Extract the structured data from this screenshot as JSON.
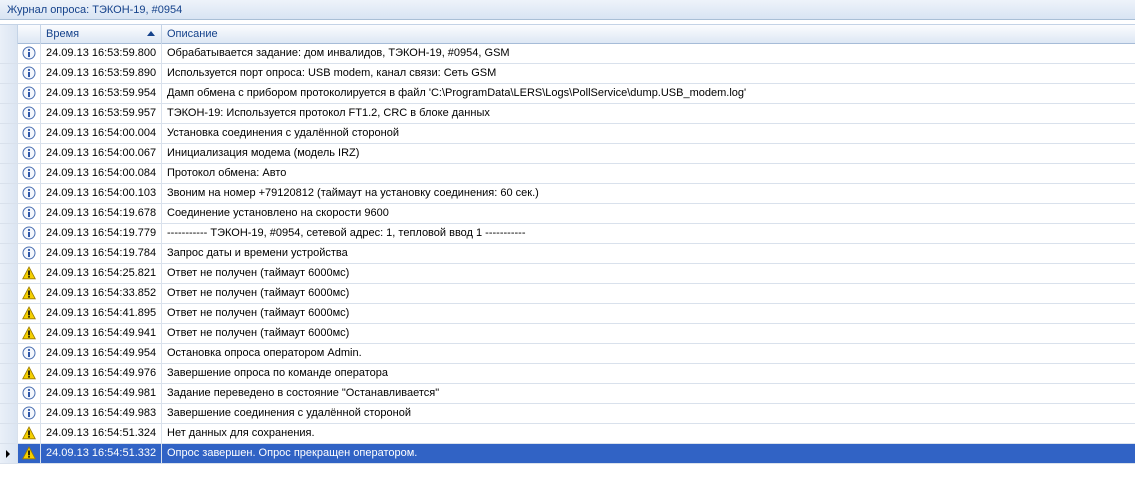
{
  "window": {
    "title": "Журнал опроса: ТЭКОН-19, #0954"
  },
  "columns": {
    "time": "Время",
    "description": "Описание"
  },
  "colors": {
    "info": "#4a6fb1",
    "warning": "#f5d000",
    "selected": "#3163c5"
  },
  "rows": [
    {
      "icon": "info",
      "time": "24.09.13 16:53:59.800",
      "text": "Обрабатывается задание: дом инвалидов, ТЭКОН-19, #0954, GSM"
    },
    {
      "icon": "info",
      "time": "24.09.13 16:53:59.890",
      "text": "Используется порт опроса: USB modem, канал связи: Сеть GSM"
    },
    {
      "icon": "info",
      "time": "24.09.13 16:53:59.954",
      "text": "Дамп обмена с прибором протоколируется в файл 'C:\\ProgramData\\LERS\\Logs\\PollService\\dump.USB_modem.log'"
    },
    {
      "icon": "info",
      "time": "24.09.13 16:53:59.957",
      "text": "ТЭКОН-19: Используется протокол FT1.2, CRC в блоке данных"
    },
    {
      "icon": "info",
      "time": "24.09.13 16:54:00.004",
      "text": "Установка соединения с удалённой стороной"
    },
    {
      "icon": "info",
      "time": "24.09.13 16:54:00.067",
      "text": "Инициализация модема (модель IRZ)"
    },
    {
      "icon": "info",
      "time": "24.09.13 16:54:00.084",
      "text": "Протокол обмена: Авто"
    },
    {
      "icon": "info",
      "time": "24.09.13 16:54:00.103",
      "text": "Звоним на номер +79120812     (таймаут на установку соединения: 60 сек.)"
    },
    {
      "icon": "info",
      "time": "24.09.13 16:54:19.678",
      "text": "Соединение установлено на скорости 9600"
    },
    {
      "icon": "info",
      "time": "24.09.13 16:54:19.779",
      "text": "----------- ТЭКОН-19, #0954, сетевой адрес: 1, тепловой ввод 1 -----------"
    },
    {
      "icon": "info",
      "time": "24.09.13 16:54:19.784",
      "text": "Запрос даты и времени устройства"
    },
    {
      "icon": "warning",
      "time": "24.09.13 16:54:25.821",
      "text": "Ответ не получен (таймаут 6000мс)"
    },
    {
      "icon": "warning",
      "time": "24.09.13 16:54:33.852",
      "text": "Ответ не получен (таймаут 6000мс)"
    },
    {
      "icon": "warning",
      "time": "24.09.13 16:54:41.895",
      "text": "Ответ не получен (таймаут 6000мс)"
    },
    {
      "icon": "warning",
      "time": "24.09.13 16:54:49.941",
      "text": "Ответ не получен (таймаут 6000мс)"
    },
    {
      "icon": "info",
      "time": "24.09.13 16:54:49.954",
      "text": "Остановка опроса оператором Admin."
    },
    {
      "icon": "warning",
      "time": "24.09.13 16:54:49.976",
      "text": "Завершение опроса по команде оператора"
    },
    {
      "icon": "info",
      "time": "24.09.13 16:54:49.981",
      "text": "Задание переведено в состояние \"Останавливается\""
    },
    {
      "icon": "info",
      "time": "24.09.13 16:54:49.983",
      "text": "Завершение соединения с удалённой стороной"
    },
    {
      "icon": "warning",
      "time": "24.09.13 16:54:51.324",
      "text": "Нет данных для сохранения."
    },
    {
      "icon": "warning",
      "time": "24.09.13 16:54:51.332",
      "text": "Опрос завершен. Опрос прекращен оператором.",
      "selected": true
    }
  ]
}
